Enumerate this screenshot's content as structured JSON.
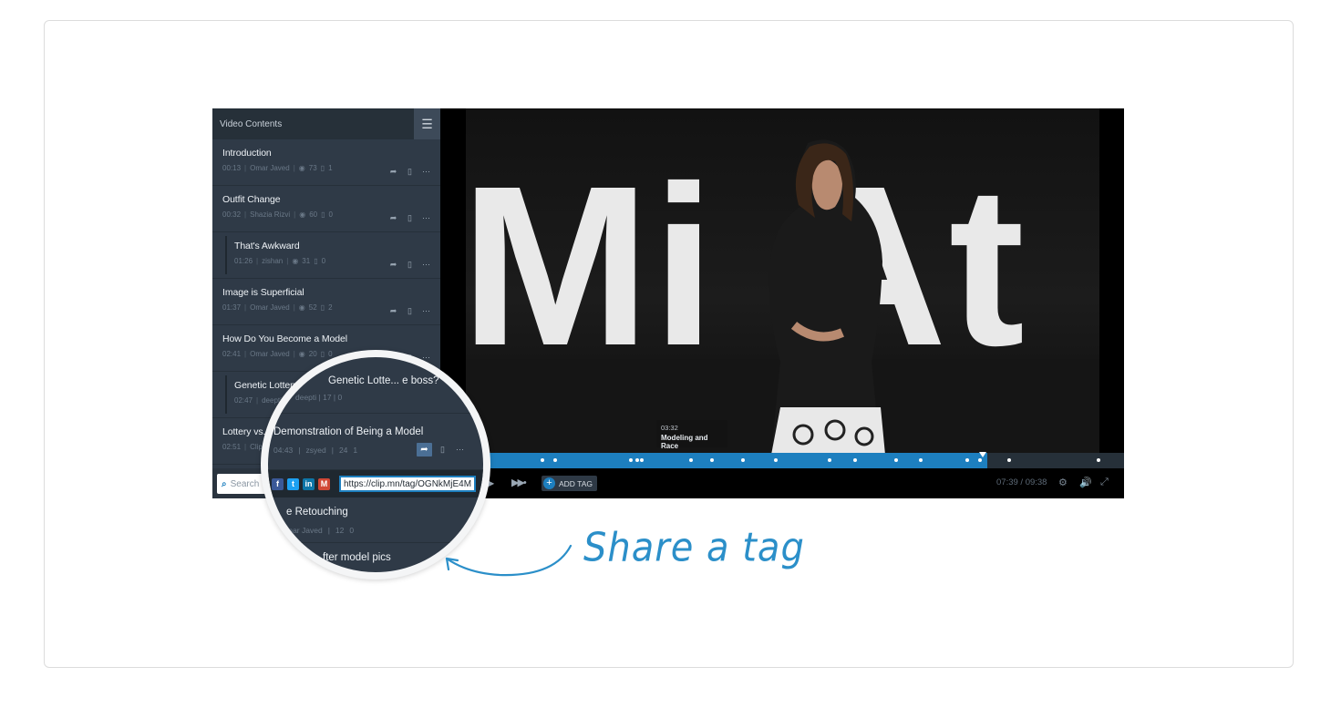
{
  "sidebar": {
    "title": "Video Contents",
    "menu_icon": "hamburger-icon",
    "items": [
      {
        "name": "Introduction",
        "time": "00:13",
        "author": "Omar Javed",
        "views": "73",
        "bookmarks": "1",
        "child": false
      },
      {
        "name": "Outfit Change",
        "time": "00:32",
        "author": "Shazia Rizvi",
        "views": "60",
        "bookmarks": "0",
        "child": false
      },
      {
        "name": "That's Awkward",
        "time": "01:26",
        "author": "zishan",
        "views": "31",
        "bookmarks": "0",
        "child": true
      },
      {
        "name": "Image is Superficial",
        "time": "01:37",
        "author": "Omar Javed",
        "views": "52",
        "bookmarks": "2",
        "child": false
      },
      {
        "name": "How Do You Become a Model",
        "time": "02:41",
        "author": "Omar Javed",
        "views": "20",
        "bookmarks": "0",
        "child": false
      },
      {
        "name": "Genetic Lottery",
        "time": "02:47",
        "author": "deepti",
        "views": "17",
        "bookmarks": "0",
        "child": true
      },
      {
        "name": "Lottery vs.",
        "time": "02:51",
        "author": "Clip",
        "views": "",
        "bookmarks": "",
        "child": false
      }
    ],
    "search_placeholder": "Search"
  },
  "video": {
    "tooltip_time": "03:32",
    "tooltip_name": "Modeling and Race",
    "add_tag_label": "ADD TAG",
    "timecode": "07:39 / 09:38",
    "progress_fraction": 0.8
  },
  "magnifier": {
    "rows": [
      {
        "title": "Genetic Lotte... e boss?",
        "meta": "deepti  |  17  |  0"
      },
      {
        "title": "Demonstration of Being a Model",
        "time": "04:43",
        "author": "zsyed",
        "views": "24",
        "bookmarks": "1"
      },
      {
        "title": "e Retouching",
        "author": "mar Javed",
        "views": "12",
        "bookmarks": "0"
      },
      {
        "title": "fter model pics"
      }
    ],
    "share_url": "https://clip.mn/tag/OGNkMjE4M",
    "social": [
      "f",
      "t",
      "in",
      "M"
    ]
  },
  "callout": {
    "text": "Share a tag"
  },
  "colors": {
    "accent": "#1d7fbf",
    "sidebar_bg": "#2f3a47",
    "callout": "#2b8fc9"
  }
}
